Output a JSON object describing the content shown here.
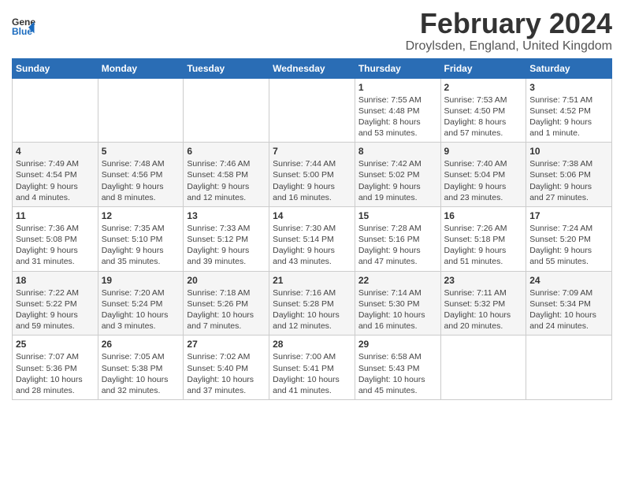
{
  "header": {
    "logo_general": "General",
    "logo_blue": "Blue",
    "month_title": "February 2024",
    "location": "Droylsden, England, United Kingdom"
  },
  "days_of_week": [
    "Sunday",
    "Monday",
    "Tuesday",
    "Wednesday",
    "Thursday",
    "Friday",
    "Saturday"
  ],
  "weeks": [
    [
      {
        "day": "",
        "info": ""
      },
      {
        "day": "",
        "info": ""
      },
      {
        "day": "",
        "info": ""
      },
      {
        "day": "",
        "info": ""
      },
      {
        "day": "1",
        "info": "Sunrise: 7:55 AM\nSunset: 4:48 PM\nDaylight: 8 hours\nand 53 minutes."
      },
      {
        "day": "2",
        "info": "Sunrise: 7:53 AM\nSunset: 4:50 PM\nDaylight: 8 hours\nand 57 minutes."
      },
      {
        "day": "3",
        "info": "Sunrise: 7:51 AM\nSunset: 4:52 PM\nDaylight: 9 hours\nand 1 minute."
      }
    ],
    [
      {
        "day": "4",
        "info": "Sunrise: 7:49 AM\nSunset: 4:54 PM\nDaylight: 9 hours\nand 4 minutes."
      },
      {
        "day": "5",
        "info": "Sunrise: 7:48 AM\nSunset: 4:56 PM\nDaylight: 9 hours\nand 8 minutes."
      },
      {
        "day": "6",
        "info": "Sunrise: 7:46 AM\nSunset: 4:58 PM\nDaylight: 9 hours\nand 12 minutes."
      },
      {
        "day": "7",
        "info": "Sunrise: 7:44 AM\nSunset: 5:00 PM\nDaylight: 9 hours\nand 16 minutes."
      },
      {
        "day": "8",
        "info": "Sunrise: 7:42 AM\nSunset: 5:02 PM\nDaylight: 9 hours\nand 19 minutes."
      },
      {
        "day": "9",
        "info": "Sunrise: 7:40 AM\nSunset: 5:04 PM\nDaylight: 9 hours\nand 23 minutes."
      },
      {
        "day": "10",
        "info": "Sunrise: 7:38 AM\nSunset: 5:06 PM\nDaylight: 9 hours\nand 27 minutes."
      }
    ],
    [
      {
        "day": "11",
        "info": "Sunrise: 7:36 AM\nSunset: 5:08 PM\nDaylight: 9 hours\nand 31 minutes."
      },
      {
        "day": "12",
        "info": "Sunrise: 7:35 AM\nSunset: 5:10 PM\nDaylight: 9 hours\nand 35 minutes."
      },
      {
        "day": "13",
        "info": "Sunrise: 7:33 AM\nSunset: 5:12 PM\nDaylight: 9 hours\nand 39 minutes."
      },
      {
        "day": "14",
        "info": "Sunrise: 7:30 AM\nSunset: 5:14 PM\nDaylight: 9 hours\nand 43 minutes."
      },
      {
        "day": "15",
        "info": "Sunrise: 7:28 AM\nSunset: 5:16 PM\nDaylight: 9 hours\nand 47 minutes."
      },
      {
        "day": "16",
        "info": "Sunrise: 7:26 AM\nSunset: 5:18 PM\nDaylight: 9 hours\nand 51 minutes."
      },
      {
        "day": "17",
        "info": "Sunrise: 7:24 AM\nSunset: 5:20 PM\nDaylight: 9 hours\nand 55 minutes."
      }
    ],
    [
      {
        "day": "18",
        "info": "Sunrise: 7:22 AM\nSunset: 5:22 PM\nDaylight: 9 hours\nand 59 minutes."
      },
      {
        "day": "19",
        "info": "Sunrise: 7:20 AM\nSunset: 5:24 PM\nDaylight: 10 hours\nand 3 minutes."
      },
      {
        "day": "20",
        "info": "Sunrise: 7:18 AM\nSunset: 5:26 PM\nDaylight: 10 hours\nand 7 minutes."
      },
      {
        "day": "21",
        "info": "Sunrise: 7:16 AM\nSunset: 5:28 PM\nDaylight: 10 hours\nand 12 minutes."
      },
      {
        "day": "22",
        "info": "Sunrise: 7:14 AM\nSunset: 5:30 PM\nDaylight: 10 hours\nand 16 minutes."
      },
      {
        "day": "23",
        "info": "Sunrise: 7:11 AM\nSunset: 5:32 PM\nDaylight: 10 hours\nand 20 minutes."
      },
      {
        "day": "24",
        "info": "Sunrise: 7:09 AM\nSunset: 5:34 PM\nDaylight: 10 hours\nand 24 minutes."
      }
    ],
    [
      {
        "day": "25",
        "info": "Sunrise: 7:07 AM\nSunset: 5:36 PM\nDaylight: 10 hours\nand 28 minutes."
      },
      {
        "day": "26",
        "info": "Sunrise: 7:05 AM\nSunset: 5:38 PM\nDaylight: 10 hours\nand 32 minutes."
      },
      {
        "day": "27",
        "info": "Sunrise: 7:02 AM\nSunset: 5:40 PM\nDaylight: 10 hours\nand 37 minutes."
      },
      {
        "day": "28",
        "info": "Sunrise: 7:00 AM\nSunset: 5:41 PM\nDaylight: 10 hours\nand 41 minutes."
      },
      {
        "day": "29",
        "info": "Sunrise: 6:58 AM\nSunset: 5:43 PM\nDaylight: 10 hours\nand 45 minutes."
      },
      {
        "day": "",
        "info": ""
      },
      {
        "day": "",
        "info": ""
      }
    ]
  ]
}
